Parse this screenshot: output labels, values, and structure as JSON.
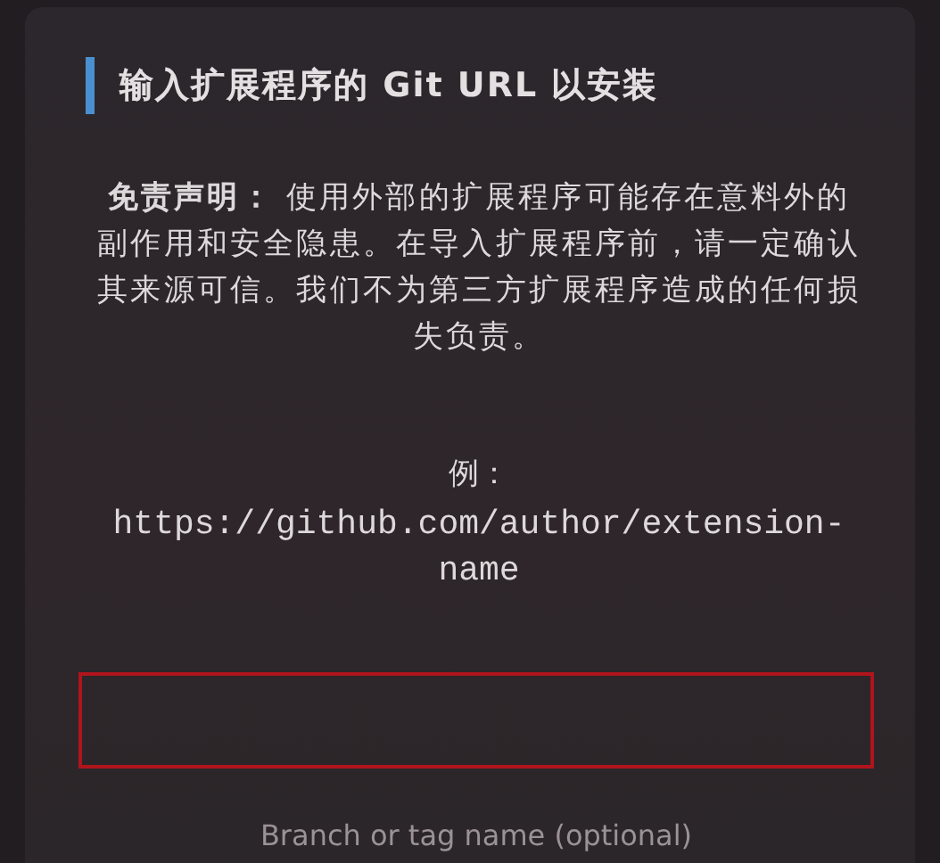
{
  "dialog": {
    "title": "输入扩展程序的 Git URL 以安装",
    "disclaimer": "**免责声明：** 使用外部的扩展程序可能存在意料外的副作用和安全隐患。在导入扩展程序前，请一定确认其来源可信。我们不为第三方扩展程序造成的任何损失负责。",
    "example_label": "例：",
    "example_url": "https://github.com/author/extension-name",
    "url_field": {
      "error": true
    },
    "branch_field": {
      "placeholder": "Branch or tag name (optional)"
    }
  }
}
